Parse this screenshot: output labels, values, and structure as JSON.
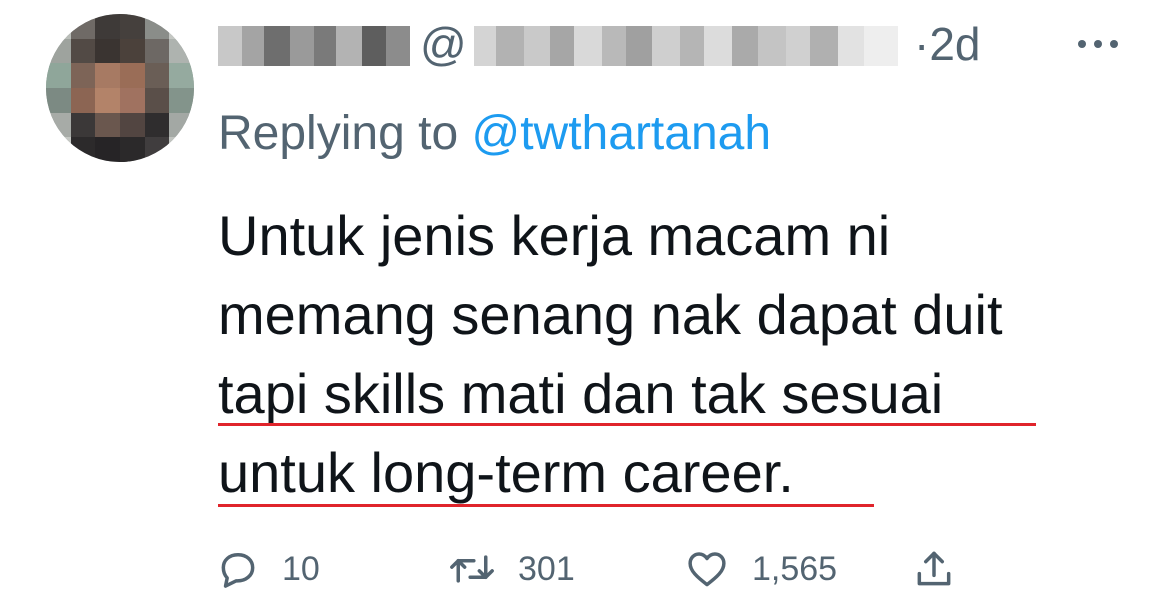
{
  "tweet": {
    "author_name": "",
    "handle_prefix": "@",
    "timestamp": "·2d",
    "reply_prefix": "Replying to",
    "reply_to": "@twthartanah",
    "text_lines": [
      "Untuk jenis kerja macam ni",
      "memang senang nak dapat duit",
      "tapi skills mati dan tak sesuai",
      "untuk long-term career."
    ],
    "highlight_color": "#e0242b",
    "link_color": "#1d9bf0"
  },
  "actions": {
    "replies": "10",
    "retweets": "301",
    "likes": "1,565"
  },
  "icons": {
    "more": "more-horizontal-icon",
    "reply": "speech-bubble-icon",
    "retweet": "retweet-arrows-icon",
    "like": "heart-icon",
    "share": "share-upload-icon"
  }
}
